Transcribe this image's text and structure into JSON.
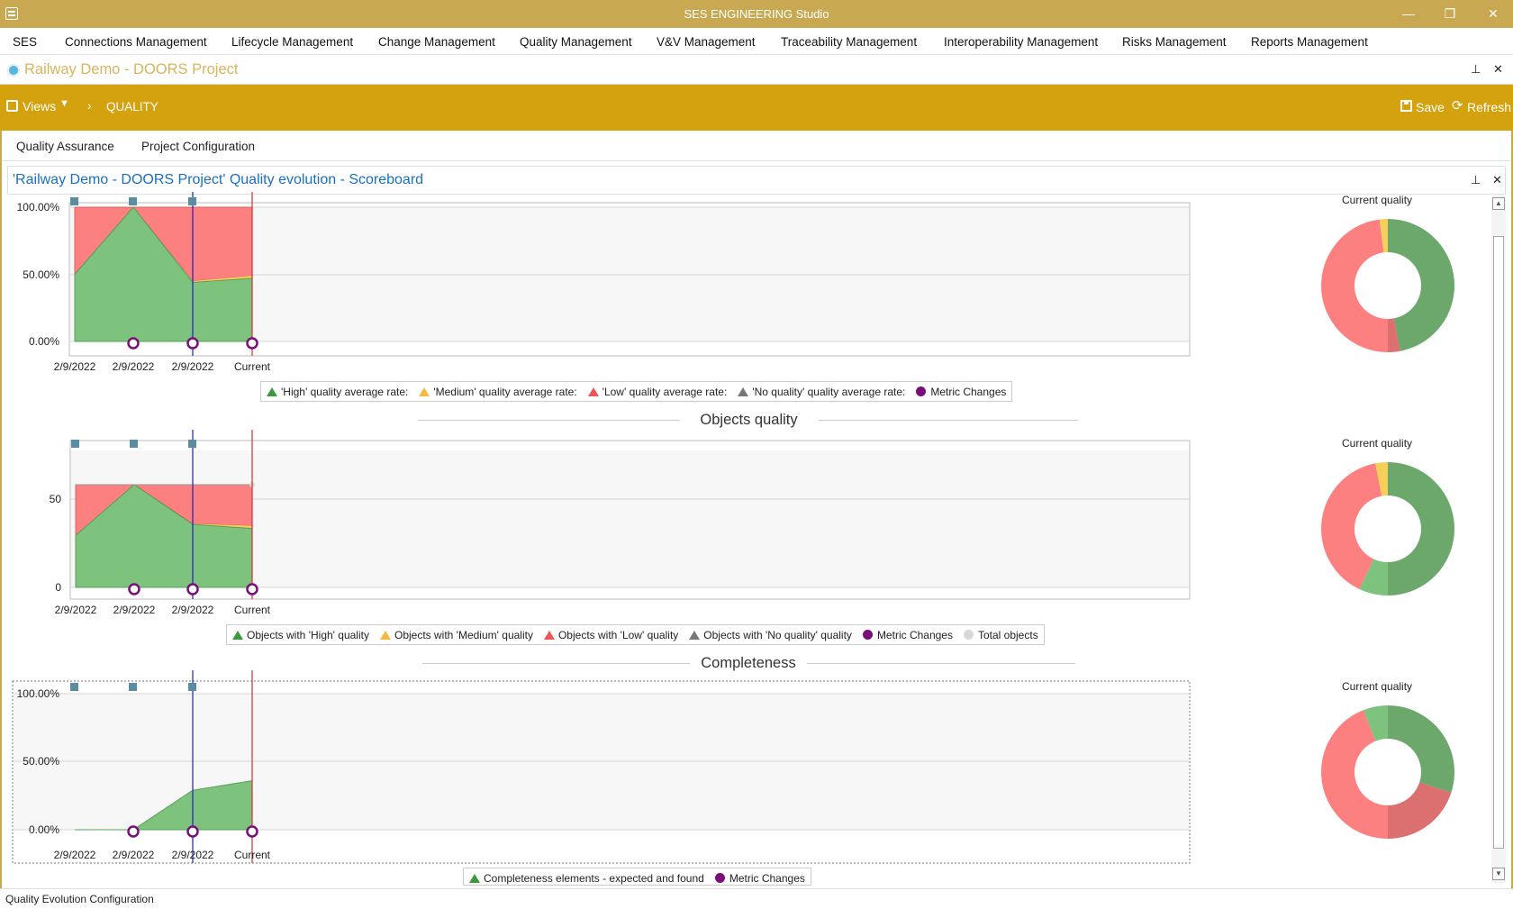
{
  "window": {
    "title": "SES ENGINEERING Studio",
    "minimize": "—",
    "restore": "❐",
    "close": "✕"
  },
  "menu": [
    "SES",
    "Connections Management",
    "Lifecycle Management",
    "Change Management",
    "Quality Management",
    "V&V Management",
    "Traceability Management",
    "Interoperability Management",
    "Risks Management",
    "Reports Management"
  ],
  "project": {
    "title": "Railway Demo - DOORS Project"
  },
  "toolbar": {
    "views": "Views",
    "breadcrumb": "QUALITY",
    "save": "Save",
    "refresh": "Refresh"
  },
  "tabs": [
    "Quality Assurance",
    "Project Configuration"
  ],
  "panel": {
    "title": "'Railway Demo - DOORS Project' Quality evolution - Scoreboard"
  },
  "colors": {
    "high": "#7dc27d",
    "medium": "#f6cf58",
    "low": "#fd8080",
    "no_quality": "#777777",
    "metric_changes": "#7a0f7a",
    "total_objects": "#d8d8d8",
    "marker": "#5b8da0",
    "current_line": "#d03030",
    "cursor_line": "#2020c0"
  },
  "sections": [
    {
      "title": "",
      "donut_label": "Current quality"
    },
    {
      "title": "Objects quality",
      "donut_label": "Current quality"
    },
    {
      "title": "Completeness",
      "donut_label": "Current quality"
    }
  ],
  "chart_data": [
    {
      "type": "area",
      "x": [
        "2/9/2022",
        "2/9/2022",
        "2/9/2022",
        "Current"
      ],
      "ylim": [
        0,
        1
      ],
      "yticks": [
        "0.00%",
        "50.00%",
        "100.00%"
      ],
      "series": [
        {
          "name": "'High' quality average rate:",
          "values": [
            0.5,
            1.0,
            0.44,
            0.47
          ]
        },
        {
          "name": "'Medium' quality average rate:",
          "values": [
            0.0,
            0.0,
            0.01,
            0.02
          ]
        },
        {
          "name": "'Low' quality average rate:",
          "values": [
            0.5,
            0.0,
            0.55,
            0.51
          ]
        },
        {
          "name": "'No quality' quality average rate:",
          "values": [
            0,
            0,
            0,
            0
          ]
        }
      ],
      "metric_changes": [
        1,
        2,
        3
      ],
      "legend": [
        "'High' quality average rate:",
        "'Medium' quality average rate:",
        "'Low' quality average rate:",
        "'No quality' quality average rate:",
        "Metric Changes"
      ],
      "donut": {
        "high": 0.47,
        "medium": 0.02,
        "low": 0.51
      }
    },
    {
      "type": "area",
      "x": [
        "2/9/2022",
        "2/9/2022",
        "2/9/2022",
        "Current"
      ],
      "ylim": [
        0,
        100
      ],
      "yticks": [
        "0",
        "50"
      ],
      "series": [
        {
          "name": "Objects with 'High' quality",
          "values": [
            38,
            75,
            46,
            43
          ]
        },
        {
          "name": "Objects with 'Medium' quality",
          "values": [
            0,
            0,
            0.5,
            2
          ]
        },
        {
          "name": "Objects with 'Low' quality",
          "values": [
            37,
            0,
            28.5,
            30
          ]
        },
        {
          "name": "Objects with 'No quality' quality",
          "values": [
            0,
            0,
            0,
            0
          ]
        }
      ],
      "total_objects": [
        75,
        75,
        75,
        75
      ],
      "metric_changes": [
        1,
        2,
        3
      ],
      "legend": [
        "Objects with 'High' quality",
        "Objects with 'Medium' quality",
        "Objects with 'Low' quality",
        "Objects with 'No quality' quality",
        "Metric Changes",
        "Total objects"
      ],
      "donut": {
        "high": 0.57,
        "medium": 0.03,
        "low": 0.4
      }
    },
    {
      "type": "area",
      "x": [
        "2/9/2022",
        "2/9/2022",
        "2/9/2022",
        "Current"
      ],
      "ylim": [
        0,
        1
      ],
      "yticks": [
        "0.00%",
        "50.00%",
        "100.00%"
      ],
      "series": [
        {
          "name": "Completeness elements - expected and found",
          "values": [
            0.0,
            0.0,
            0.29,
            0.36
          ]
        }
      ],
      "metric_changes": [
        1,
        2,
        3
      ],
      "legend": [
        "Completeness elements - expected and found",
        "Metric Changes"
      ],
      "donut": {
        "high": 0.36,
        "medium": 0.0,
        "low": 0.64
      }
    }
  ],
  "status": "Quality Evolution Configuration"
}
